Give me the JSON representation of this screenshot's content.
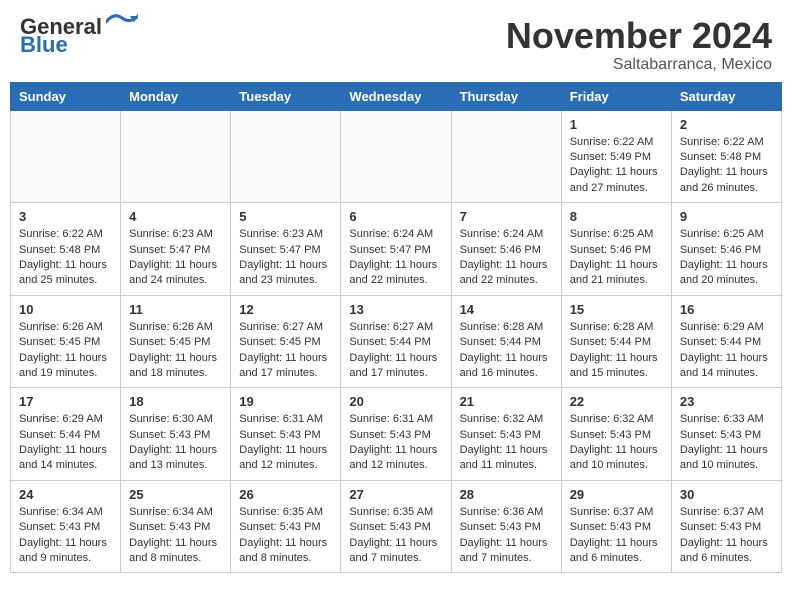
{
  "header": {
    "logo_line1": "General",
    "logo_line2": "Blue",
    "month": "November 2024",
    "location": "Saltabarranca, Mexico"
  },
  "days_of_week": [
    "Sunday",
    "Monday",
    "Tuesday",
    "Wednesday",
    "Thursday",
    "Friday",
    "Saturday"
  ],
  "weeks": [
    [
      {
        "num": "",
        "info": ""
      },
      {
        "num": "",
        "info": ""
      },
      {
        "num": "",
        "info": ""
      },
      {
        "num": "",
        "info": ""
      },
      {
        "num": "",
        "info": ""
      },
      {
        "num": "1",
        "info": "Sunrise: 6:22 AM\nSunset: 5:49 PM\nDaylight: 11 hours\nand 27 minutes."
      },
      {
        "num": "2",
        "info": "Sunrise: 6:22 AM\nSunset: 5:48 PM\nDaylight: 11 hours\nand 26 minutes."
      }
    ],
    [
      {
        "num": "3",
        "info": "Sunrise: 6:22 AM\nSunset: 5:48 PM\nDaylight: 11 hours\nand 25 minutes."
      },
      {
        "num": "4",
        "info": "Sunrise: 6:23 AM\nSunset: 5:47 PM\nDaylight: 11 hours\nand 24 minutes."
      },
      {
        "num": "5",
        "info": "Sunrise: 6:23 AM\nSunset: 5:47 PM\nDaylight: 11 hours\nand 23 minutes."
      },
      {
        "num": "6",
        "info": "Sunrise: 6:24 AM\nSunset: 5:47 PM\nDaylight: 11 hours\nand 22 minutes."
      },
      {
        "num": "7",
        "info": "Sunrise: 6:24 AM\nSunset: 5:46 PM\nDaylight: 11 hours\nand 22 minutes."
      },
      {
        "num": "8",
        "info": "Sunrise: 6:25 AM\nSunset: 5:46 PM\nDaylight: 11 hours\nand 21 minutes."
      },
      {
        "num": "9",
        "info": "Sunrise: 6:25 AM\nSunset: 5:46 PM\nDaylight: 11 hours\nand 20 minutes."
      }
    ],
    [
      {
        "num": "10",
        "info": "Sunrise: 6:26 AM\nSunset: 5:45 PM\nDaylight: 11 hours\nand 19 minutes."
      },
      {
        "num": "11",
        "info": "Sunrise: 6:26 AM\nSunset: 5:45 PM\nDaylight: 11 hours\nand 18 minutes."
      },
      {
        "num": "12",
        "info": "Sunrise: 6:27 AM\nSunset: 5:45 PM\nDaylight: 11 hours\nand 17 minutes."
      },
      {
        "num": "13",
        "info": "Sunrise: 6:27 AM\nSunset: 5:44 PM\nDaylight: 11 hours\nand 17 minutes."
      },
      {
        "num": "14",
        "info": "Sunrise: 6:28 AM\nSunset: 5:44 PM\nDaylight: 11 hours\nand 16 minutes."
      },
      {
        "num": "15",
        "info": "Sunrise: 6:28 AM\nSunset: 5:44 PM\nDaylight: 11 hours\nand 15 minutes."
      },
      {
        "num": "16",
        "info": "Sunrise: 6:29 AM\nSunset: 5:44 PM\nDaylight: 11 hours\nand 14 minutes."
      }
    ],
    [
      {
        "num": "17",
        "info": "Sunrise: 6:29 AM\nSunset: 5:44 PM\nDaylight: 11 hours\nand 14 minutes."
      },
      {
        "num": "18",
        "info": "Sunrise: 6:30 AM\nSunset: 5:43 PM\nDaylight: 11 hours\nand 13 minutes."
      },
      {
        "num": "19",
        "info": "Sunrise: 6:31 AM\nSunset: 5:43 PM\nDaylight: 11 hours\nand 12 minutes."
      },
      {
        "num": "20",
        "info": "Sunrise: 6:31 AM\nSunset: 5:43 PM\nDaylight: 11 hours\nand 12 minutes."
      },
      {
        "num": "21",
        "info": "Sunrise: 6:32 AM\nSunset: 5:43 PM\nDaylight: 11 hours\nand 11 minutes."
      },
      {
        "num": "22",
        "info": "Sunrise: 6:32 AM\nSunset: 5:43 PM\nDaylight: 11 hours\nand 10 minutes."
      },
      {
        "num": "23",
        "info": "Sunrise: 6:33 AM\nSunset: 5:43 PM\nDaylight: 11 hours\nand 10 minutes."
      }
    ],
    [
      {
        "num": "24",
        "info": "Sunrise: 6:34 AM\nSunset: 5:43 PM\nDaylight: 11 hours\nand 9 minutes."
      },
      {
        "num": "25",
        "info": "Sunrise: 6:34 AM\nSunset: 5:43 PM\nDaylight: 11 hours\nand 8 minutes."
      },
      {
        "num": "26",
        "info": "Sunrise: 6:35 AM\nSunset: 5:43 PM\nDaylight: 11 hours\nand 8 minutes."
      },
      {
        "num": "27",
        "info": "Sunrise: 6:35 AM\nSunset: 5:43 PM\nDaylight: 11 hours\nand 7 minutes."
      },
      {
        "num": "28",
        "info": "Sunrise: 6:36 AM\nSunset: 5:43 PM\nDaylight: 11 hours\nand 7 minutes."
      },
      {
        "num": "29",
        "info": "Sunrise: 6:37 AM\nSunset: 5:43 PM\nDaylight: 11 hours\nand 6 minutes."
      },
      {
        "num": "30",
        "info": "Sunrise: 6:37 AM\nSunset: 5:43 PM\nDaylight: 11 hours\nand 6 minutes."
      }
    ]
  ]
}
